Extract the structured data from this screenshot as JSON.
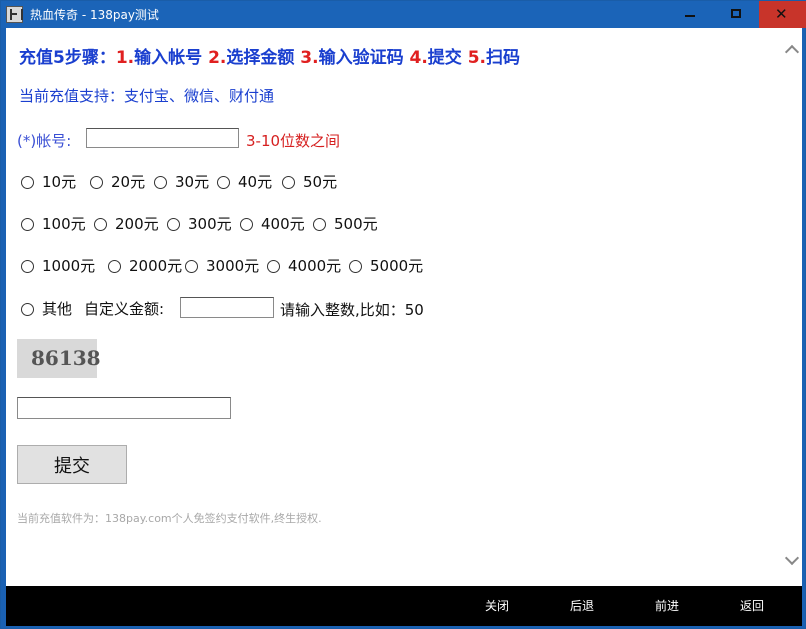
{
  "window": {
    "title": "热血传奇 - 138pay测试",
    "controls": [
      "minimize",
      "maximize",
      "close"
    ],
    "close_glyph": "✕"
  },
  "steps": {
    "prefix": "充值5步骤：",
    "items": [
      {
        "num": "1.",
        "label": "输入帐号"
      },
      {
        "num": "2.",
        "label": "选择金额"
      },
      {
        "num": "3.",
        "label": "输入验证码"
      },
      {
        "num": "4.",
        "label": "提交"
      },
      {
        "num": "5.",
        "label": "扫码"
      }
    ]
  },
  "support_text": "当前充值支持：支付宝、微信、财付通",
  "account": {
    "label": "(*)帐号:",
    "value": "",
    "hint": "3-10位数之间"
  },
  "amounts": {
    "row1": [
      "10元",
      "20元",
      "30元",
      "40元",
      "50元"
    ],
    "row2": [
      "100元",
      "200元",
      "300元",
      "400元",
      "500元"
    ],
    "row3": [
      "1000元",
      "2000元",
      "3000元",
      "4000元",
      "5000元"
    ],
    "other_label": "其他",
    "custom_label": "自定义金额:",
    "custom_value": "",
    "custom_hint": "请输入整数,比如：50"
  },
  "captcha": {
    "code": "86138",
    "input_value": ""
  },
  "submit_label": "提交",
  "footer_note": "当前充值软件为：138pay.com个人免签约支付软件,终生授权.",
  "bottom_nav": {
    "close": "关闭",
    "back": "后退",
    "forward": "前进",
    "return": "返回"
  },
  "colors": {
    "titlebar": "#1b64b8",
    "close_button": "#c8342a",
    "step_label": "#1a3fcf",
    "step_number": "#e02020",
    "hint_red": "#d62020",
    "bottom_bar": "#000000"
  }
}
